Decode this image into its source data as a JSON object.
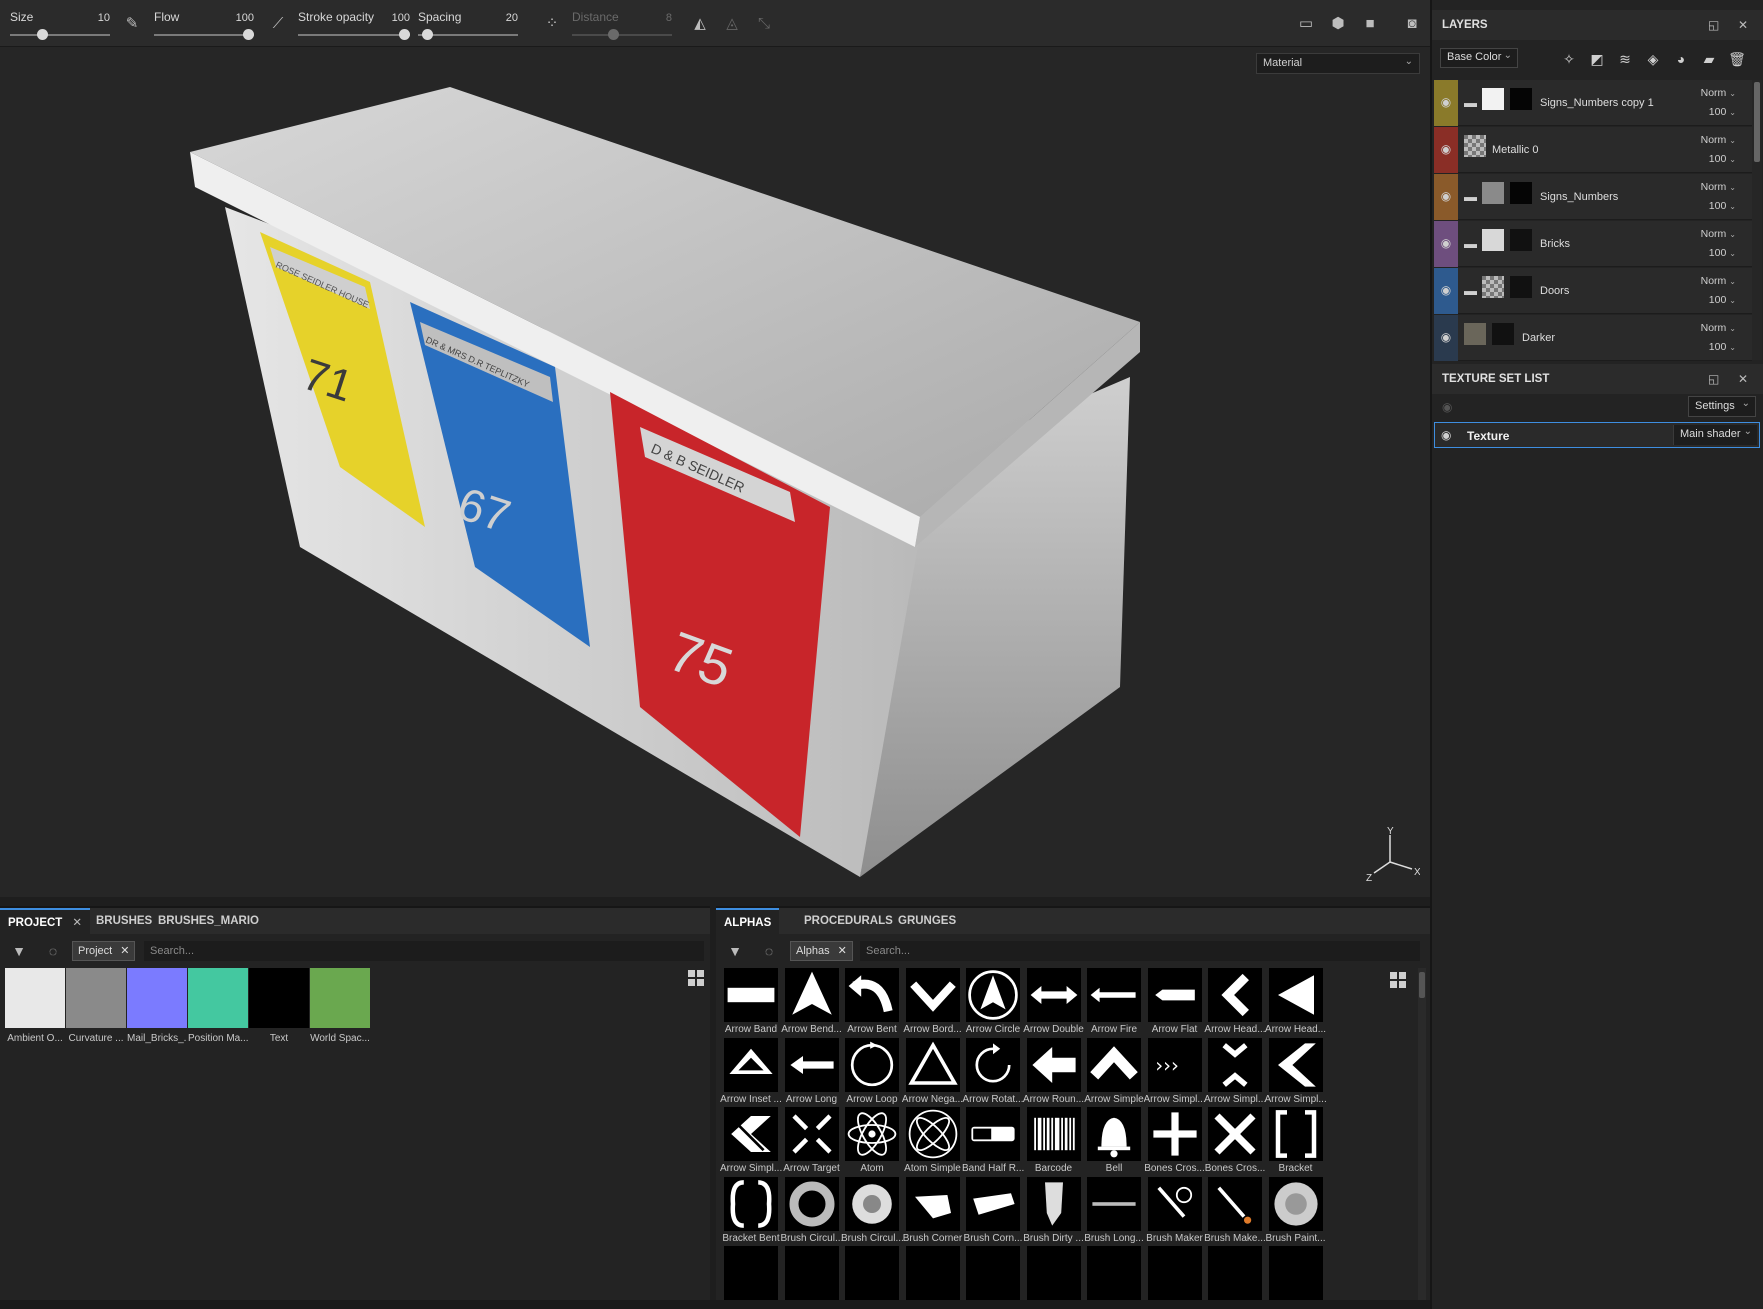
{
  "toolbar": {
    "size": {
      "label": "Size",
      "value": "10",
      "fraction": 0.3
    },
    "flow": {
      "label": "Flow",
      "value": "100",
      "fraction": 1.0
    },
    "stroke_opacity": {
      "label": "Stroke opacity",
      "value": "100",
      "fraction": 1.0
    },
    "spacing": {
      "label": "Spacing",
      "value": "20",
      "fraction": 0.05
    },
    "distance": {
      "label": "Distance",
      "value": "8",
      "fraction": 0.4
    }
  },
  "viewport": {
    "channel_select": "Material",
    "axis_labels": {
      "x": "X",
      "y": "Y",
      "z": "Z"
    },
    "mailbox": {
      "boxes": [
        {
          "number": "71",
          "sign": "ROSE SEIDLER HOUSE",
          "color": "#e6d22a"
        },
        {
          "number": "67",
          "sign": "DR & MRS D.R TEPLITZKY",
          "color": "#2a6fbf"
        },
        {
          "number": "75",
          "sign": "D & B SEIDLER",
          "color": "#c8252a"
        }
      ]
    }
  },
  "project_panel": {
    "tabs": [
      {
        "label": "PROJECT",
        "active": true
      },
      {
        "label": "BRUSHES",
        "active": false
      },
      {
        "label": "BRUSHES_MARIO",
        "active": false
      }
    ],
    "filter_chip": "Project",
    "search_placeholder": "Search...",
    "items": [
      {
        "label": "Ambient O...",
        "color": "#e8e8e8"
      },
      {
        "label": "Curvature ...",
        "color": "#8a8a8a"
      },
      {
        "label": "Mail_Bricks_...",
        "color": "#7b7bff"
      },
      {
        "label": "Position Ma...",
        "color": "#44c8a0"
      },
      {
        "label": "Text",
        "color": "#000000"
      },
      {
        "label": "World Spac...",
        "color": "#6aa84f"
      }
    ]
  },
  "alphas_panel": {
    "tabs": [
      {
        "label": "ALPHAS",
        "active": true
      },
      {
        "label": "PROCEDURALS",
        "active": false
      },
      {
        "label": "GRUNGES",
        "active": false
      }
    ],
    "filter_chip": "Alphas",
    "search_placeholder": "Search...",
    "items": [
      {
        "label": "Arrow Band",
        "icon": "band"
      },
      {
        "label": "Arrow Bend...",
        "icon": "bend"
      },
      {
        "label": "Arrow Bent",
        "icon": "bent"
      },
      {
        "label": "Arrow Bord...",
        "icon": "vdown"
      },
      {
        "label": "Arrow Circle",
        "icon": "circle"
      },
      {
        "label": "Arrow Double",
        "icon": "double"
      },
      {
        "label": "Arrow Fire",
        "icon": "fire"
      },
      {
        "label": "Arrow Flat",
        "icon": "flat"
      },
      {
        "label": "Arrow Head...",
        "icon": "lt"
      },
      {
        "label": "Arrow Head...",
        "icon": "tri-left"
      },
      {
        "label": "Arrow Inset ...",
        "icon": "inset"
      },
      {
        "label": "Arrow Long",
        "icon": "long"
      },
      {
        "label": "Arrow Loop",
        "icon": "loop"
      },
      {
        "label": "Arrow Nega...",
        "icon": "tri-outline"
      },
      {
        "label": "Arrow Rotat...",
        "icon": "rotate"
      },
      {
        "label": "Arrow Roun...",
        "icon": "round-left"
      },
      {
        "label": "Arrow Simple",
        "icon": "caret-up"
      },
      {
        "label": "Arrow Simpl...",
        "icon": "dots"
      },
      {
        "label": "Arrow Simpl...",
        "icon": "xchev"
      },
      {
        "label": "Arrow Simpl...",
        "icon": "chev-left"
      },
      {
        "label": "Arrow Simpl...",
        "icon": "stripes"
      },
      {
        "label": "Arrow Target",
        "icon": "target"
      },
      {
        "label": "Atom",
        "icon": "atom"
      },
      {
        "label": "Atom Simple",
        "icon": "atom2"
      },
      {
        "label": "Band Half R...",
        "icon": "halfband"
      },
      {
        "label": "Barcode",
        "icon": "barcode"
      },
      {
        "label": "Bell",
        "icon": "bell"
      },
      {
        "label": "Bones Cros...",
        "icon": "cross"
      },
      {
        "label": "Bones Cros...",
        "icon": "bones"
      },
      {
        "label": "Bracket",
        "icon": "bracket"
      },
      {
        "label": "Bracket Bent",
        "icon": "bracket2"
      },
      {
        "label": "Brush Circul...",
        "icon": "swirl"
      },
      {
        "label": "Brush Circul...",
        "icon": "swirl2"
      },
      {
        "label": "Brush Corner",
        "icon": "blob"
      },
      {
        "label": "Brush Corn...",
        "icon": "blob2"
      },
      {
        "label": "Brush Dirty ...",
        "icon": "dirty"
      },
      {
        "label": "Brush Long...",
        "icon": "longstroke"
      },
      {
        "label": "Brush Maker",
        "icon": "maker"
      },
      {
        "label": "Brush Make...",
        "icon": "maker2"
      },
      {
        "label": "Brush Paint...",
        "icon": "paint"
      }
    ]
  },
  "layers_panel": {
    "title": "LAYERS",
    "channel_select": "Base Color",
    "layers": [
      {
        "name": "Signs_Numbers copy 1",
        "mode": "Norm",
        "opacity": "100",
        "color": "#8a7a2a",
        "folder": true,
        "thumb1": "#f2f2f2",
        "thumb2": "#050505"
      },
      {
        "name": "Metallic 0",
        "mode": "Norm",
        "opacity": "100",
        "color": "#8a2e26",
        "folder": false,
        "thumb1": "checker",
        "thumb2": ""
      },
      {
        "name": "Signs_Numbers",
        "mode": "Norm",
        "opacity": "100",
        "color": "#8a5a2a",
        "folder": true,
        "thumb1": "#8a8a8a",
        "thumb2": "#050505"
      },
      {
        "name": "Bricks",
        "mode": "Norm",
        "opacity": "100",
        "color": "#6e4e7e",
        "folder": true,
        "thumb1": "#d8d8d8",
        "thumb2": "#111111"
      },
      {
        "name": "Doors",
        "mode": "Norm",
        "opacity": "100",
        "color": "#2e5a8e",
        "folder": true,
        "thumb1": "checker",
        "thumb2": "#111111"
      },
      {
        "name": "Darker",
        "mode": "Norm",
        "opacity": "100",
        "color": "#2a3a4e",
        "folder": false,
        "thumb1": "#6a665a",
        "thumb2": "#111111"
      }
    ]
  },
  "texture_set_panel": {
    "title": "TEXTURE SET LIST",
    "settings_label": "Settings",
    "texture_name": "Texture",
    "shader": "Main shader"
  }
}
